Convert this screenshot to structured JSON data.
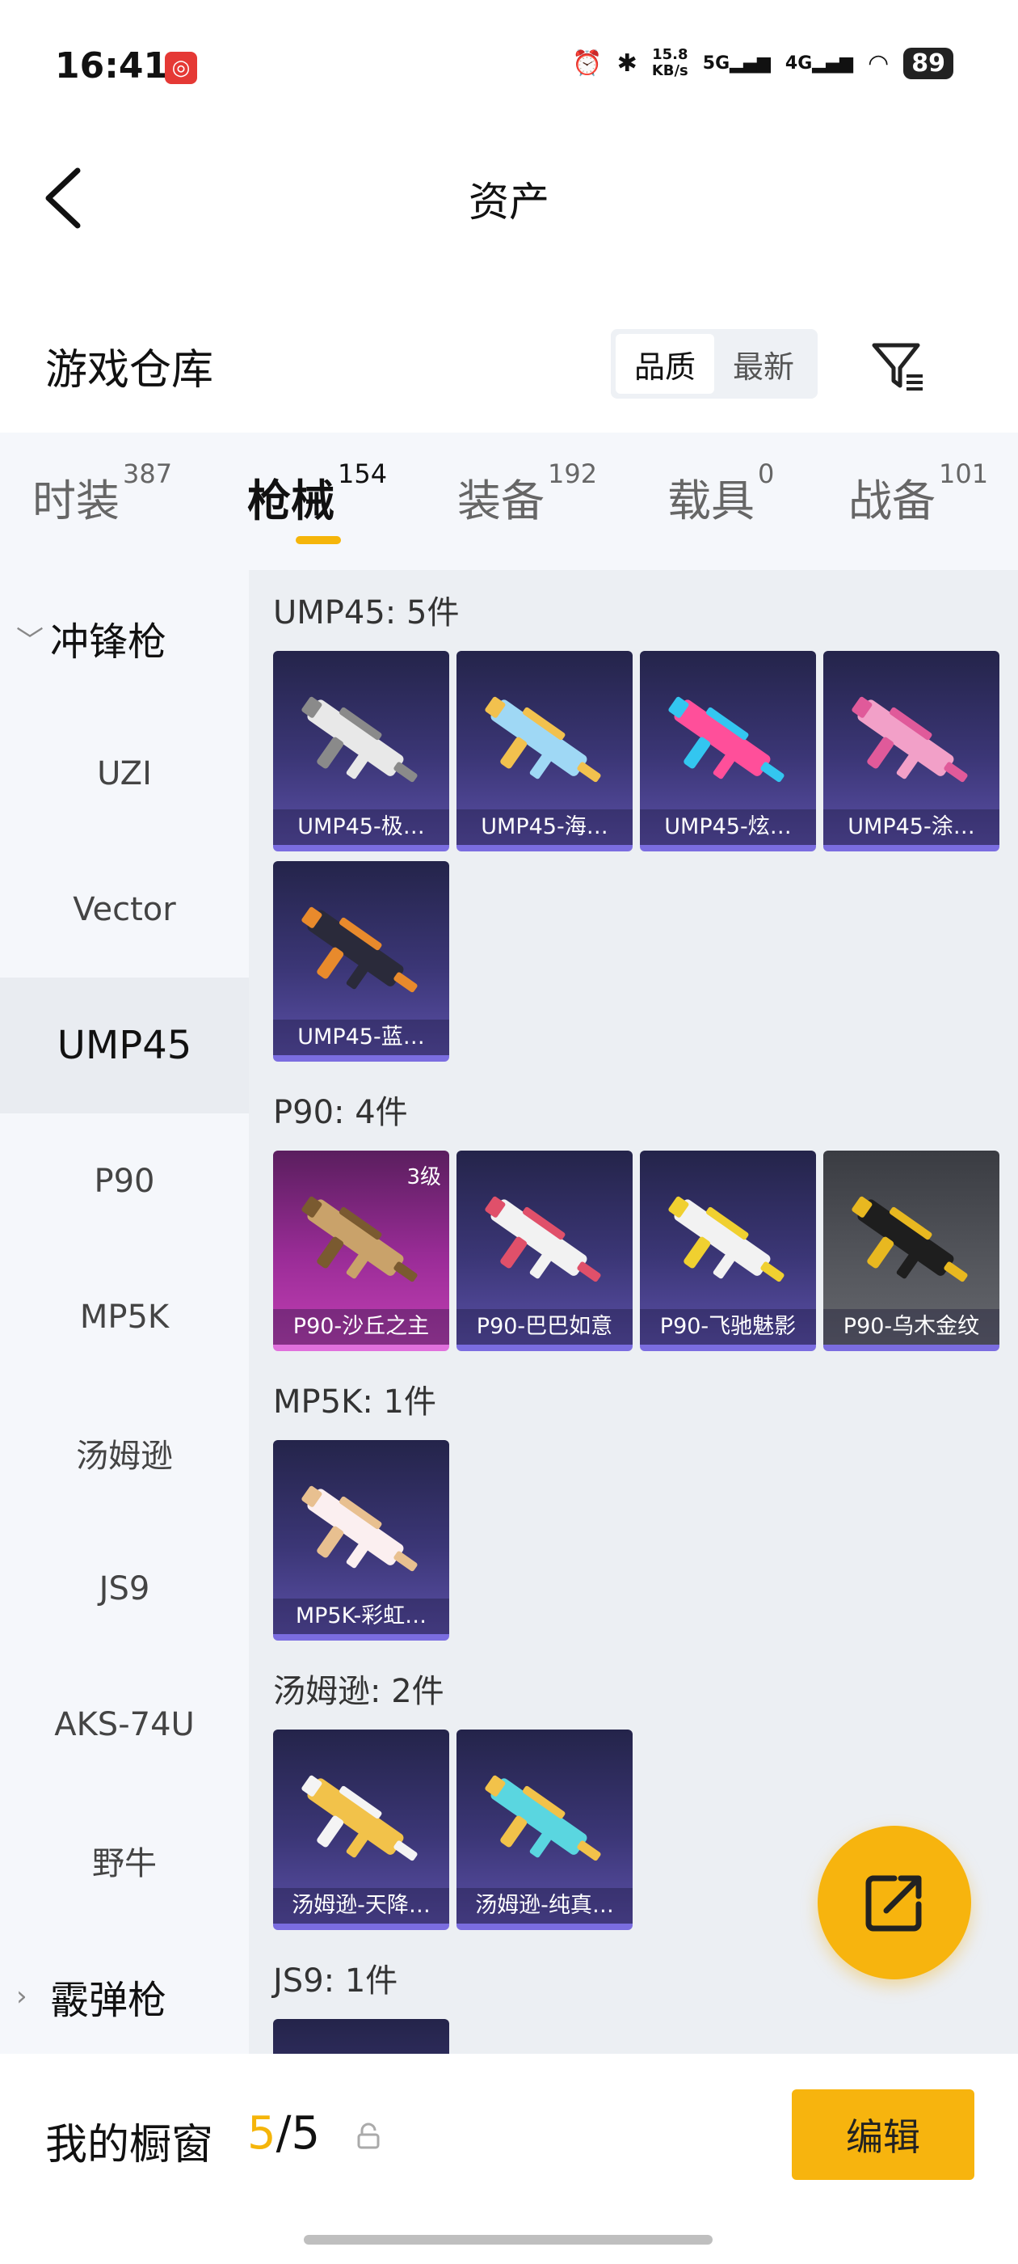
{
  "status_bar": {
    "time": "16:41",
    "app_badge": "◎",
    "speed_top": "15.8",
    "speed_unit": "KB/s",
    "net1": "5G",
    "net2": "4G",
    "battery": "89"
  },
  "header": {
    "title": "资产"
  },
  "warehouse": {
    "title": "游戏仓库",
    "sort_options": [
      "品质",
      "最新"
    ],
    "active_sort": "品质"
  },
  "tabs": [
    {
      "label": "时装",
      "count": "387"
    },
    {
      "label": "枪械",
      "count": "154"
    },
    {
      "label": "装备",
      "count": "192"
    },
    {
      "label": "载具",
      "count": "0"
    },
    {
      "label": "战备",
      "count": "101"
    }
  ],
  "active_tab": "枪械",
  "sidebar": {
    "group_open": "冲锋枪",
    "items": [
      "UZI",
      "Vector",
      "UMP45",
      "P90",
      "MP5K",
      "汤姆逊",
      "JS9",
      "AKS-74U",
      "野牛"
    ],
    "active_item": "UMP45",
    "group_closed": "霰弹枪"
  },
  "sections": [
    {
      "label": "UMP45: 5件",
      "cards": [
        {
          "name": "UMP45-极…",
          "rarity": "purple",
          "colors": [
            "#e8e8e8",
            "#8a8a8a"
          ]
        },
        {
          "name": "UMP45-海…",
          "rarity": "purple",
          "colors": [
            "#9fd8f5",
            "#f2c14e"
          ]
        },
        {
          "name": "UMP45-炫…",
          "rarity": "purple",
          "colors": [
            "#ff4f9a",
            "#33c6f0"
          ]
        },
        {
          "name": "UMP45-涂…",
          "rarity": "purple",
          "colors": [
            "#f2a0c8",
            "#e05a9a"
          ]
        },
        {
          "name": "UMP45-蓝…",
          "rarity": "purple",
          "colors": [
            "#2a2a3a",
            "#e88a2c"
          ]
        }
      ]
    },
    {
      "label": "P90: 4件",
      "cards": [
        {
          "name": "P90-沙丘之主",
          "rarity": "pink",
          "level": "3级",
          "colors": [
            "#c9a26a",
            "#7a5a30"
          ]
        },
        {
          "name": "P90-巴巴如意",
          "rarity": "purple",
          "colors": [
            "#f2f2f2",
            "#e0506a"
          ]
        },
        {
          "name": "P90-飞驰魅影",
          "rarity": "purple",
          "colors": [
            "#f2f2f2",
            "#f0d030"
          ]
        },
        {
          "name": "P90-乌木金纹",
          "rarity": "grey",
          "colors": [
            "#1e1e1e",
            "#e8b820"
          ]
        }
      ]
    },
    {
      "label": "MP5K: 1件",
      "cards": [
        {
          "name": "MP5K-彩虹…",
          "rarity": "purple",
          "colors": [
            "#fbeff0",
            "#e8c090"
          ]
        }
      ]
    },
    {
      "label": "汤姆逊: 2件",
      "cards": [
        {
          "name": "汤姆逊-天降…",
          "rarity": "purple",
          "colors": [
            "#f2c24a",
            "#f4f4f4"
          ]
        },
        {
          "name": "汤姆逊-纯真…",
          "rarity": "purple",
          "colors": [
            "#5ad6e0",
            "#f2c24a"
          ]
        }
      ]
    },
    {
      "label": "JS9: 1件",
      "cards": [
        {
          "name": "",
          "rarity": "purple",
          "colors": [
            "#2a2a3a",
            "#5a5a7a"
          ]
        }
      ]
    }
  ],
  "showcase": {
    "label": "我的橱窗",
    "current": "5",
    "separator": "/",
    "total": "5",
    "edit_label": "编辑"
  },
  "accent_color": "#f7b40e"
}
